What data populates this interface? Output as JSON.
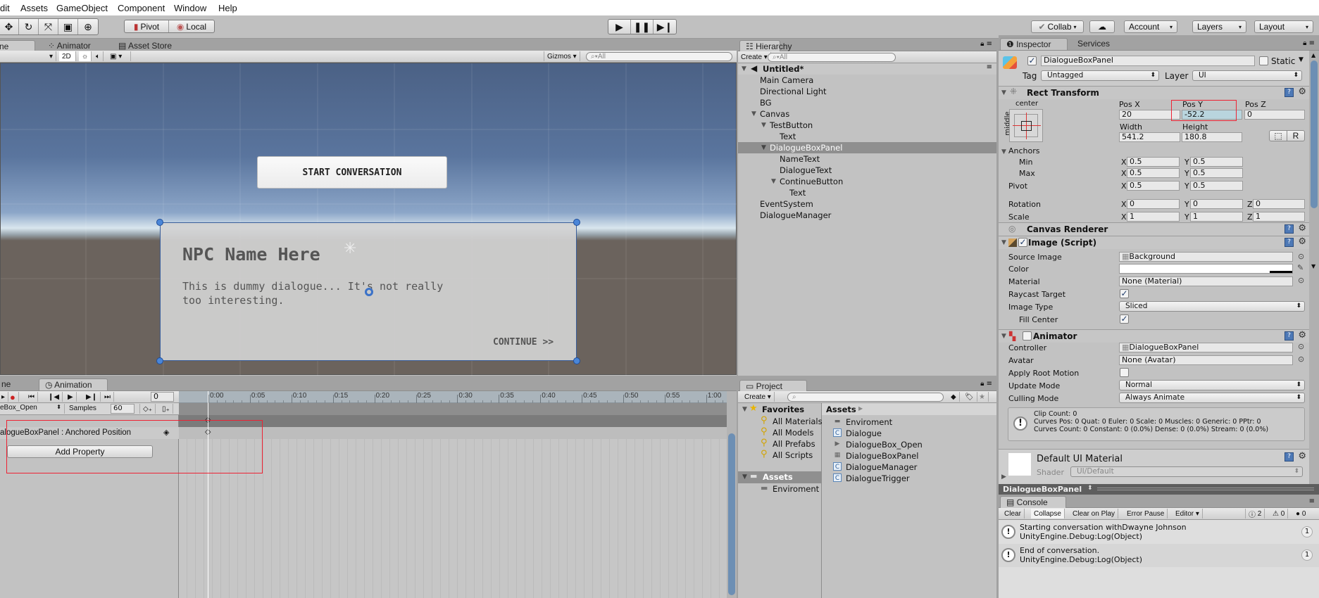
{
  "menu": [
    "dit",
    "Assets",
    "GameObject",
    "Component",
    "Window",
    "Help"
  ],
  "toolbar": {
    "tools": [
      "move-tool",
      "rotate-tool",
      "scale-tool",
      "rect-tool",
      "transform-tool"
    ],
    "pivot": "Pivot",
    "local": "Local",
    "collab": "Collab",
    "account": "Account",
    "layers": "Layers",
    "layout": "Layout"
  },
  "scene": {
    "tabs": [
      "ne",
      "Animator",
      "Asset Store"
    ],
    "mode_2d": "2D",
    "gizmos": "Gizmos",
    "search_placeholder": "All",
    "start_button": "START CONVERSATION",
    "npc_name": "NPC Name Here",
    "dialogue": "This is dummy dialogue... It's not really too interesting.",
    "continue": "CONTINUE >>",
    "colors": {
      "sky_top": "#4b6185",
      "horizon": "#d9e6ee",
      "ground": "#6b635d"
    }
  },
  "animation": {
    "tabs": [
      "Animation"
    ],
    "frame": "0",
    "clip": "eBox_Open",
    "samples_label": "Samples",
    "samples": "60",
    "property": "alogueBoxPanel : Anchored Position",
    "add_property": "Add Property",
    "time_labels": [
      "0:00",
      "0:05",
      "0:10",
      "0:15",
      "0:20",
      "0:25",
      "0:30",
      "0:35",
      "0:40",
      "0:45",
      "0:50",
      "0:55",
      "1:00"
    ]
  },
  "hierarchy": {
    "tab": "Hierarchy",
    "create": "Create",
    "search_placeholder": "All",
    "scene": "Untitled*",
    "items": [
      {
        "label": "Main Camera",
        "depth": 0
      },
      {
        "label": "Directional Light",
        "depth": 0
      },
      {
        "label": "BG",
        "depth": 0
      },
      {
        "label": "Canvas",
        "depth": 0,
        "expanded": true
      },
      {
        "label": "TestButton",
        "depth": 1,
        "expanded": true
      },
      {
        "label": "Text",
        "depth": 2
      },
      {
        "label": "DialogueBoxPanel",
        "depth": 1,
        "expanded": true,
        "selected": true
      },
      {
        "label": "NameText",
        "depth": 2
      },
      {
        "label": "DialogueText",
        "depth": 2
      },
      {
        "label": "ContinueButton",
        "depth": 2,
        "expanded": true
      },
      {
        "label": "Text",
        "depth": 3
      },
      {
        "label": "EventSystem",
        "depth": 0
      },
      {
        "label": "DialogueManager",
        "depth": 0
      }
    ]
  },
  "project": {
    "tab": "Project",
    "create": "Create",
    "favorites": "Favorites",
    "favorite_items": [
      "All Materials",
      "All Models",
      "All Prefabs",
      "All Scripts"
    ],
    "assets": "Assets",
    "asset_folders": [
      "Enviroment"
    ],
    "breadcrumb": "Assets",
    "files": [
      {
        "label": "Enviroment",
        "icon": "folder-icon"
      },
      {
        "label": "Dialogue",
        "icon": "csharp-script-icon"
      },
      {
        "label": "DialogueBox_Open",
        "icon": "animation-clip-icon"
      },
      {
        "label": "DialogueBoxPanel",
        "icon": "animator-controller-icon"
      },
      {
        "label": "DialogueManager",
        "icon": "csharp-script-icon"
      },
      {
        "label": "DialogueTrigger",
        "icon": "csharp-script-icon"
      }
    ]
  },
  "inspector": {
    "tabs": [
      "Inspector",
      "Services"
    ],
    "object_name": "DialogueBoxPanel",
    "static": "Static",
    "tag_label": "Tag",
    "tag": "Untagged",
    "layer_label": "Layer",
    "layer": "UI",
    "rect": {
      "title": "Rect Transform",
      "anchor_h": "center",
      "anchor_v": "middle",
      "pos_x_label": "Pos X",
      "pos_y_label": "Pos Y",
      "pos_z_label": "Pos Z",
      "pos_x": "20",
      "pos_y": "-52.2",
      "pos_z": "0",
      "width_label": "Width",
      "height_label": "Height",
      "width": "541.2",
      "height": "180.8",
      "r_button": "R",
      "anchors": "Anchors",
      "min": "Min",
      "max": "Max",
      "pivot": "Pivot",
      "min_x": "0.5",
      "min_y": "0.5",
      "max_x": "0.5",
      "max_y": "0.5",
      "pivot_x": "0.5",
      "pivot_y": "0.5",
      "rotation": "Rotation",
      "rot_x": "0",
      "rot_y": "0",
      "rot_z": "0",
      "scale": "Scale",
      "scale_x": "1",
      "scale_y": "1",
      "scale_z": "1",
      "x": "X",
      "y": "Y",
      "z": "Z"
    },
    "canvas_renderer": "Canvas Renderer",
    "image": {
      "title": "Image (Script)",
      "source_label": "Source Image",
      "source": "Background",
      "color_label": "Color",
      "color": "#ffffff",
      "material_label": "Material",
      "material": "None (Material)",
      "raycast_label": "Raycast Target",
      "type_label": "Image Type",
      "type": "Sliced",
      "fill_label": "Fill Center"
    },
    "animator": {
      "title": "Animator",
      "controller_label": "Controller",
      "controller": "DialogueBoxPanel",
      "avatar_label": "Avatar",
      "avatar": "None (Avatar)",
      "root_motion_label": "Apply Root Motion",
      "update_label": "Update Mode",
      "update": "Normal",
      "culling_label": "Culling Mode",
      "culling": "Always Animate",
      "info": [
        "Clip Count: 0",
        "Curves Pos: 0 Quat: 0 Euler: 0 Scale: 0 Muscles: 0 Generic: 0 PPtr: 0",
        "Curves Count: 0 Constant: 0 (0.0%) Dense: 0 (0.0%) Stream: 0 (0.0%)"
      ]
    },
    "material": {
      "name": "Default UI Material",
      "shader_label": "Shader",
      "shader": "UI/Default"
    },
    "footer": "DialogueBoxPanel"
  },
  "console": {
    "tab": "Console",
    "buttons": [
      "Clear",
      "Collapse",
      "Clear on Play",
      "Error Pause",
      "Editor"
    ],
    "counts": {
      "info": "2",
      "warn": "0",
      "error": "0"
    },
    "entries": [
      {
        "line1": "Starting conversation withDwayne Johnson",
        "line2": "UnityEngine.Debug:Log(Object)",
        "count": "1"
      },
      {
        "line1": "End of conversation.",
        "line2": "UnityEngine.Debug:Log(Object)",
        "count": "1"
      }
    ]
  }
}
